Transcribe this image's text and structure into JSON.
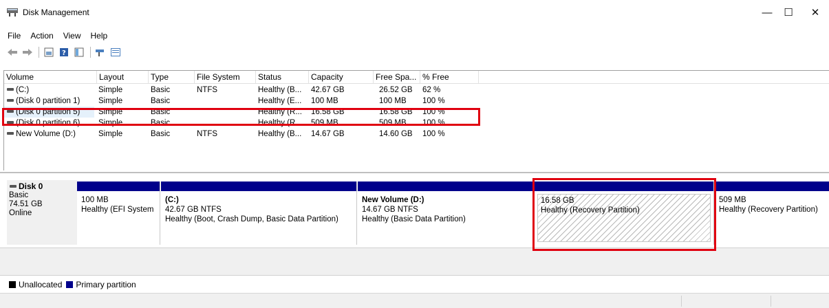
{
  "window": {
    "title": "Disk Management",
    "minimize": "—",
    "maximize": "☐",
    "close": "✕"
  },
  "menu": [
    "File",
    "Action",
    "View",
    "Help"
  ],
  "toolbar": {
    "buttons": [
      "back-arrow-icon",
      "forward-arrow-icon",
      "properties-icon",
      "help-icon",
      "show-hide-icon",
      "connect-icon",
      "view-icon"
    ]
  },
  "volume_table": {
    "columns": [
      "Volume",
      "Layout",
      "Type",
      "File System",
      "Status",
      "Capacity",
      "Free Spa...",
      "% Free"
    ],
    "rows": [
      {
        "volume": "(C:)",
        "layout": "Simple",
        "type": "Basic",
        "fs": "NTFS",
        "status": "Healthy (B...",
        "capacity": "42.67 GB",
        "free": "26.52 GB",
        "pct": "62 %"
      },
      {
        "volume": "(Disk 0 partition 1)",
        "layout": "Simple",
        "type": "Basic",
        "fs": "",
        "status": "Healthy (E...",
        "capacity": "100 MB",
        "free": "100 MB",
        "pct": "100 %"
      },
      {
        "volume": "(Disk 0 partition 5)",
        "layout": "Simple",
        "type": "Basic",
        "fs": "",
        "status": "Healthy (R...",
        "capacity": "16.58 GB",
        "free": "16.58 GB",
        "pct": "100 %"
      },
      {
        "volume": "(Disk 0 partition 6)",
        "layout": "Simple",
        "type": "Basic",
        "fs": "",
        "status": "Healthy (R...",
        "capacity": "509 MB",
        "free": "509 MB",
        "pct": "100 %"
      },
      {
        "volume": "New Volume (D:)",
        "layout": "Simple",
        "type": "Basic",
        "fs": "NTFS",
        "status": "Healthy (B...",
        "capacity": "14.67 GB",
        "free": "14.60 GB",
        "pct": "100 %"
      }
    ]
  },
  "disk": {
    "name": "Disk 0",
    "type": "Basic",
    "size": "74.51 GB",
    "state": "Online"
  },
  "partitions": [
    {
      "title": "",
      "size": "100 MB",
      "status": "Healthy (EFI System"
    },
    {
      "title": "(C:)",
      "size": "42.67 GB NTFS",
      "status": "Healthy (Boot, Crash Dump, Basic Data Partition)"
    },
    {
      "title": "New Volume  (D:)",
      "size": "14.67 GB NTFS",
      "status": "Healthy (Basic Data Partition)"
    },
    {
      "title": "",
      "size": "16.58 GB",
      "status": "Healthy (Recovery Partition)"
    },
    {
      "title": "",
      "size": "509 MB",
      "status": "Healthy (Recovery Partition)"
    }
  ],
  "legend": {
    "unallocated": "Unallocated",
    "primary": "Primary partition",
    "unallocated_color": "#000000",
    "primary_color": "#00008b"
  },
  "highlight_color": "#e0000f"
}
